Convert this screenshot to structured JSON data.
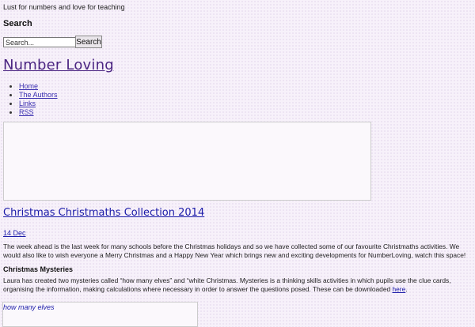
{
  "header": {
    "tagline": "Lust for numbers and love for teaching",
    "site_title": "Number Loving"
  },
  "search": {
    "heading": "Search",
    "input_value": "Search...",
    "button_label": "Search"
  },
  "nav": {
    "items": [
      {
        "label": "Home"
      },
      {
        "label": "The Authors"
      },
      {
        "label": "Links"
      },
      {
        "label": "RSS"
      }
    ]
  },
  "post": {
    "title": "Christmas Christmaths Collection 2014",
    "date": "14 Dec",
    "paragraph1": "The week ahead is the last week for many schools before the Christmas holidays and so we have collected some of our favourite Christmaths activities. We would also like to wish everyone a Merry Christmas and a Happy New Year which brings new and exciting developments for NumberLoving, watch this space!",
    "subheading": "Christmas Mysteries",
    "paragraph2": "Laura has created two mysteries called “how many elves” and “white Christmas. Mysteries is a thinking skills activities in which pupils use the clue cards, organising the information, making calculations where necessary in order to answer the questions posed. These can be downloaded ",
    "download_link": "here",
    "paragraph2_end": ".",
    "embed_caption": "how many elves"
  }
}
